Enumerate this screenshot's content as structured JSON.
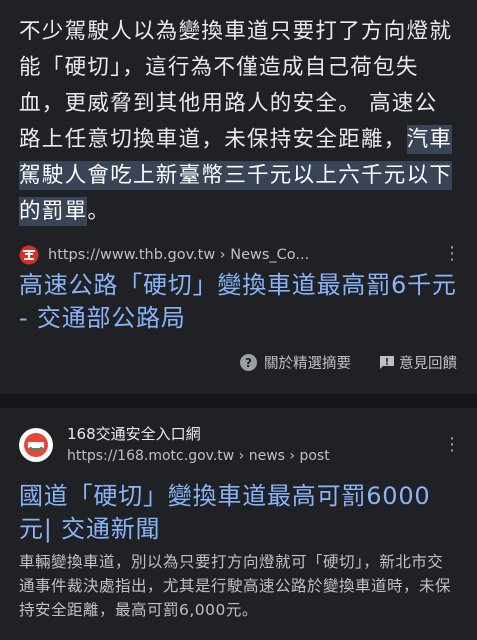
{
  "snippet": {
    "text_before": "不少駕駛人以為變換車道只要打了方向燈就能「硬切」，這行為不僅造成自己荷包失血，更威脅到其他用路人的安全。 高速公路上任意切換車道，未保持安全距離，",
    "text_highlight": "汽車駕駛人會吃上新臺幣三千元以上六千元以下的罰單",
    "text_after": "。"
  },
  "result1": {
    "url": "https://www.thb.gov.tw › News_Co...",
    "title": "高速公路「硬切」變換車道最高罰6千元 - 交通部公路局",
    "favicon_icon": "thb-logo-icon"
  },
  "feedback": {
    "about_label": "關於精選摘要",
    "feedback_label": "意見回饋"
  },
  "result2": {
    "site_name": "168交通安全入口網",
    "url": "https://168.motc.gov.tw › news › post",
    "title": "國道「硬切」變換車道最高可罰6000元| 交通新聞",
    "description": "車輛變換車道，別以為只要打方向燈就可「硬切」，新北市交通事件裁決處指出，尤其是行駛高速公路於變換車道時，未保持安全距離，最高可罰6,000元。",
    "favicon_icon": "168-logo-icon"
  },
  "colors": {
    "background": "#202124",
    "link": "#8ab4f8",
    "highlight": "#394457",
    "text": "#e8eaed",
    "muted": "#bdc1c6"
  }
}
